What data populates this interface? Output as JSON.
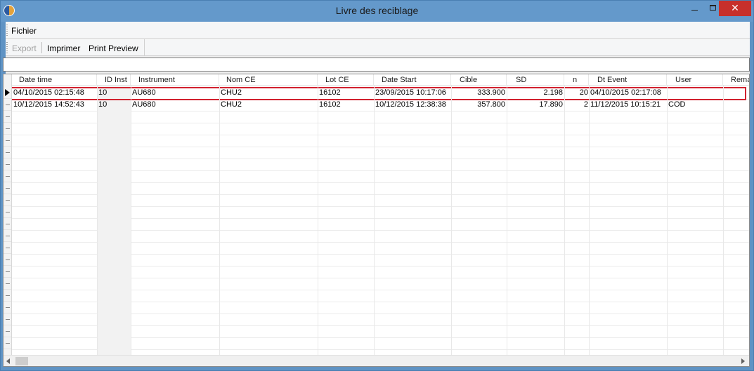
{
  "window": {
    "title": "Livre des reciblage",
    "minimize_icon": "minimize-icon",
    "maximize_icon": "maximize-icon",
    "close_label": "✕",
    "app_icon": "app-logo-icon"
  },
  "menu": {
    "items": [
      {
        "label": "Fichier"
      }
    ]
  },
  "toolbar": {
    "export_label": "Export",
    "print_label": "Imprimer",
    "preview_label": "Print Preview"
  },
  "filter": {
    "value": ""
  },
  "grid": {
    "columns": [
      {
        "label": "Date time"
      },
      {
        "label": "ID Inst"
      },
      {
        "label": "Instrument"
      },
      {
        "label": "Nom CE"
      },
      {
        "label": "Lot CE"
      },
      {
        "label": "Date Start"
      },
      {
        "label": "Cible"
      },
      {
        "label": "SD"
      },
      {
        "label": "n"
      },
      {
        "label": "Dt Event"
      },
      {
        "label": "User"
      },
      {
        "label": "Rema"
      }
    ],
    "rows": [
      {
        "date_time": "04/10/2015 02:15:48",
        "id_inst": "10",
        "instrument": "AU680",
        "nom_ce": "CHU2",
        "lot_ce": "16102",
        "date_start": "23/09/2015 10:17:06",
        "cible": "333.900",
        "sd": "2.198",
        "n": "20",
        "dt_event": "04/10/2015 02:17:08",
        "user": "",
        "rema": ""
      },
      {
        "date_time": "10/12/2015 14:52:43",
        "id_inst": "10",
        "instrument": "AU680",
        "nom_ce": "CHU2",
        "lot_ce": "16102",
        "date_start": "10/12/2015 12:38:38",
        "cible": "357.800",
        "sd": "17.890",
        "n": "2",
        "dt_event": "11/12/2015 10:15:21",
        "user": "COD",
        "rema": ""
      }
    ],
    "current_row_indicator": "row-pointer-icon"
  },
  "scrollbar": {
    "left_icon": "scroll-left-icon",
    "right_icon": "scroll-right-icon"
  }
}
